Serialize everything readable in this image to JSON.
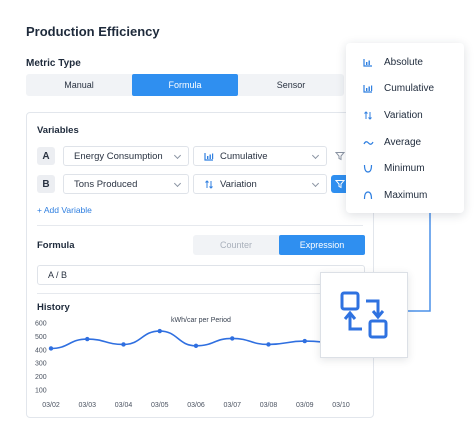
{
  "title": "Production Efficiency",
  "metric_type": {
    "label": "Metric Type",
    "options": [
      "Manual",
      "Formula",
      "Sensor"
    ],
    "selected": "Formula"
  },
  "variables": {
    "label": "Variables",
    "rows": [
      {
        "letter": "A",
        "source": "Energy Consumption",
        "aggregation": "Cumulative",
        "aggregation_icon": "bar-chart-icon"
      },
      {
        "letter": "B",
        "source": "Tons Produced",
        "aggregation": "Variation",
        "aggregation_icon": "variation-icon"
      }
    ],
    "add_label": "+ Add Variable"
  },
  "formula": {
    "label": "Formula",
    "modes": [
      "Counter",
      "Expression"
    ],
    "selected_mode": "Expression",
    "value": "A / B"
  },
  "history": {
    "label": "History"
  },
  "aggregation_menu": {
    "items": [
      {
        "label": "Absolute",
        "icon": "bar-chart-icon"
      },
      {
        "label": "Cumulative",
        "icon": "bar-chart-icon"
      },
      {
        "label": "Variation",
        "icon": "variation-icon"
      },
      {
        "label": "Average",
        "icon": "wave-icon"
      },
      {
        "label": "Minimum",
        "icon": "minimum-icon"
      },
      {
        "label": "Maximum",
        "icon": "maximum-icon"
      }
    ]
  },
  "colors": {
    "accent": "#2f8ff0",
    "line": "#2f6fe0"
  },
  "chart_data": {
    "type": "line",
    "title": "kWh/car per Period",
    "x": [
      "03/02",
      "03/03",
      "03/04",
      "03/05",
      "03/06",
      "03/07",
      "03/08",
      "03/09",
      "03/10"
    ],
    "values": [
      410,
      480,
      440,
      540,
      430,
      485,
      440,
      465,
      450
    ],
    "ylim": [
      100,
      600
    ],
    "yticks": [
      100,
      200,
      300,
      400,
      500,
      600
    ],
    "grid": false
  }
}
